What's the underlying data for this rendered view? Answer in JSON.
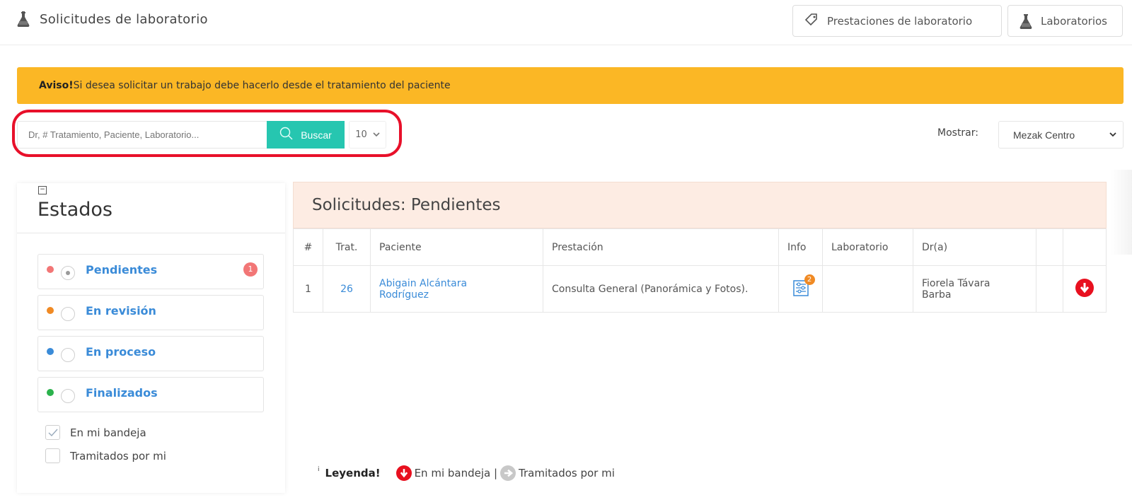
{
  "header": {
    "title": "Solicitudes de laboratorio",
    "buttons": [
      {
        "label": "Prestaciones de laboratorio",
        "icon": "tag-icon"
      },
      {
        "label": "Laboratorios",
        "icon": "flask-icon"
      }
    ]
  },
  "notice": {
    "prefix": "Aviso!",
    "text": "Si desea solicitar un trabajo debe hacerlo desde el tratamiento del paciente",
    "color": "#fbb725"
  },
  "search": {
    "placeholder": "Dr, # Tratamiento, Paciente, Laboratorio...",
    "button_label": "Buscar",
    "page_size": "10",
    "accent": "#26c6b0"
  },
  "filter": {
    "label": "Mostrar:",
    "branch": "Mezak Centro"
  },
  "states": {
    "title": "Estados",
    "items": [
      {
        "label": "Pendientes",
        "color": "#f27676",
        "selected": true,
        "count": "1"
      },
      {
        "label": "En revisión",
        "color": "#f08a24",
        "selected": false
      },
      {
        "label": "En proceso",
        "color": "#3a8bd8",
        "selected": false
      },
      {
        "label": "Finalizados",
        "color": "#2bb24c",
        "selected": false
      }
    ],
    "checkboxes": [
      {
        "label": "En mi bandeja",
        "checked": true
      },
      {
        "label": "Tramitados por mi",
        "checked": false
      }
    ]
  },
  "requests": {
    "title": "Solicitudes: Pendientes",
    "columns": [
      "#",
      "Trat.",
      "Paciente",
      "Prestación",
      "Info",
      "Laboratorio",
      "Dr(a)",
      "",
      ""
    ],
    "rows": [
      {
        "num": "1",
        "trat": "26",
        "paciente_line1": "Abigain Alcántara",
        "paciente_line2": "Rodríguez",
        "prestacion": "Consulta General (Panorámica y Fotos).",
        "info_count": "2",
        "laboratorio": "",
        "doctor_line1": "Fiorela Távara",
        "doctor_line2": "Barba"
      }
    ]
  },
  "legend": {
    "marker": "i",
    "label": "Leyenda!",
    "item1": "En mi bandeja |",
    "item2": "Tramitados por mi"
  }
}
